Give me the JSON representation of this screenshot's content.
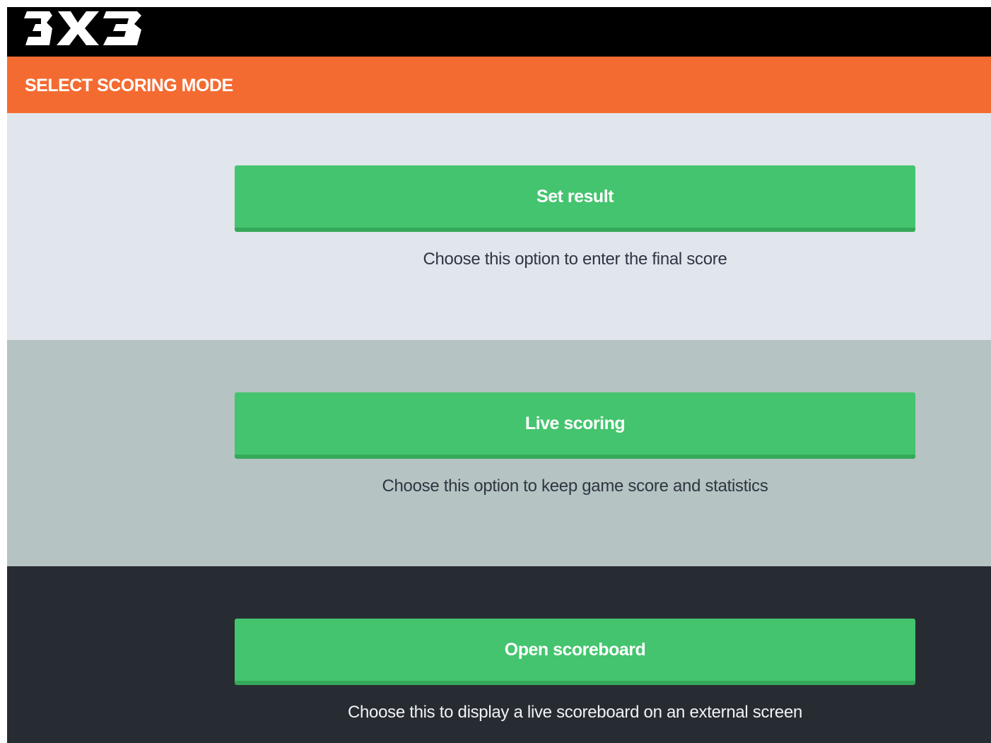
{
  "header": {
    "logo_text": "3X3",
    "page_title": "SELECT SCORING MODE"
  },
  "options": [
    {
      "button_label": "Set result",
      "description": "Choose this option to enter the final score"
    },
    {
      "button_label": "Live scoring",
      "description": "Choose this option to keep game score and statistics"
    },
    {
      "button_label": "Open scoreboard",
      "description": "Choose this to display a live scoreboard on an external screen"
    }
  ],
  "colors": {
    "header_bg": "#000000",
    "title_bar": "#f46b31",
    "section_1_bg": "#e1e5ec",
    "section_2_bg": "#b5c3c2",
    "section_3_bg": "#272c33",
    "button_green": "#44c46e",
    "button_shadow": "#35a95a"
  }
}
